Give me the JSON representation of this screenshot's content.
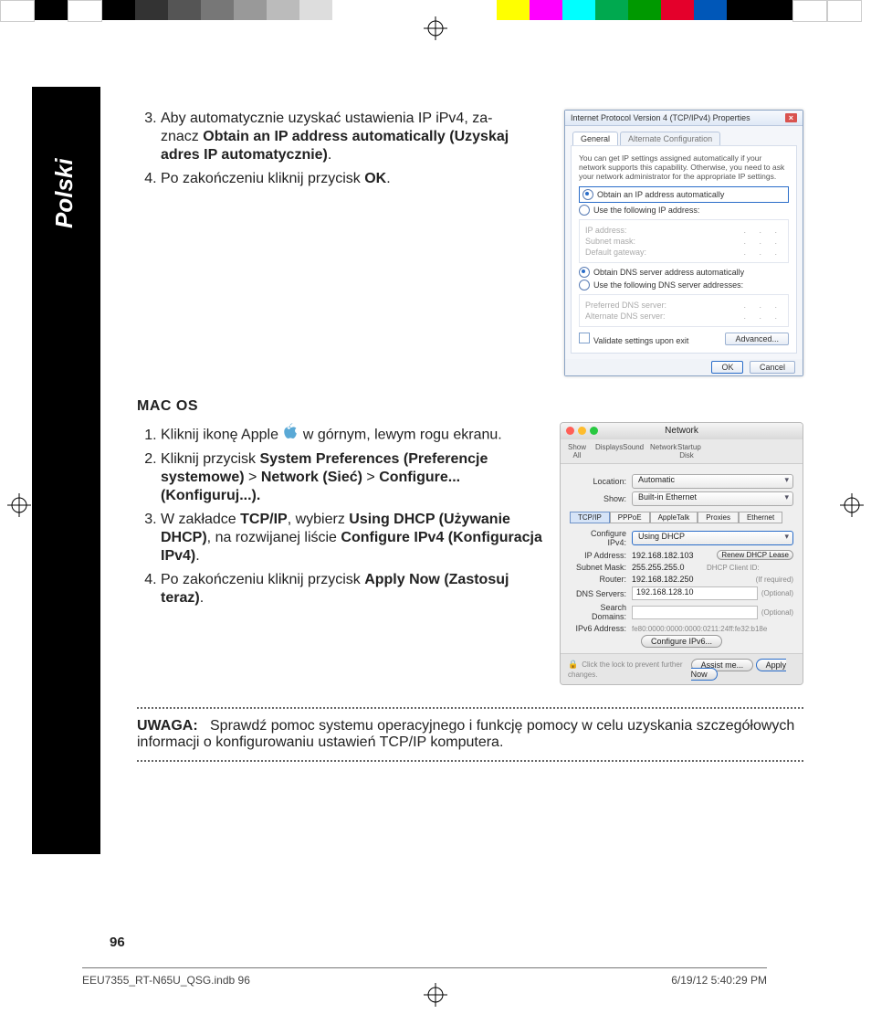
{
  "side_tab": "Polski",
  "section_win": {
    "steps": [
      {
        "num": "3.",
        "pre": "Aby automatycznie uzyskać ustawienia IP iPv4, za-",
        "pre2": "znacz ",
        "bold": "Obtain an IP address automatically (Uzyskaj adres IP automatycznie)",
        "post": "."
      },
      {
        "num": "4.",
        "text_pre": "Po zakończeniu kliknij przycisk ",
        "bold": "OK",
        "post": "."
      }
    ]
  },
  "win_dialog": {
    "title": "Internet Protocol Version 4 (TCP/IPv4) Properties",
    "tabs": [
      "General",
      "Alternate Configuration"
    ],
    "hint": "You can get IP settings assigned automatically if your network supports this capability. Otherwise, you need to ask your network administrator for the appropriate IP settings.",
    "radio_auto_ip": "Obtain an IP address automatically",
    "radio_use_ip": "Use the following IP address:",
    "fields_ip": [
      "IP address:",
      "Subnet mask:",
      "Default gateway:"
    ],
    "radio_auto_dns": "Obtain DNS server address automatically",
    "radio_use_dns": "Use the following DNS server addresses:",
    "fields_dns": [
      "Preferred DNS server:",
      "Alternate DNS server:"
    ],
    "validate": "Validate settings upon exit",
    "advanced": "Advanced...",
    "ok": "OK",
    "cancel": "Cancel"
  },
  "mac_heading": "MAC OS",
  "section_mac": {
    "steps": [
      {
        "num": "1.",
        "pre": "Kliknij ikonę Apple ",
        "post": " w górnym, lewym rogu ekranu."
      },
      {
        "num": "2.",
        "pre": "Kliknij przycisk ",
        "bold": "System Preferences (Preferencje systemowe)",
        "mid1": " > ",
        "bold2": "Network (Sieć)",
        "mid2": " > ",
        "bold3": "Configure... (Konfiguruj...).",
        "post": ""
      },
      {
        "num": "3.",
        "pre": "W zakładce ",
        "bold": "TCP/IP",
        "mid1": ", wybierz ",
        "bold2": "Using DHCP (Używanie DHCP)",
        "mid2": ", na rozwijanej liście ",
        "bold3": "Configure IPv4 (Konfiguracja IPv4)",
        "post": "."
      },
      {
        "num": "4.",
        "pre": "Po zakończeniu kliknij przycisk  ",
        "bold": "Apply Now (Zastosuj teraz)",
        "post": "."
      }
    ]
  },
  "mac_window": {
    "title": "Network",
    "toolbar": [
      "Show All",
      "Displays",
      "Sound",
      "Network",
      "Startup Disk"
    ],
    "loc_label": "Location:",
    "loc_value": "Automatic",
    "show_label": "Show:",
    "show_value": "Built-in Ethernet",
    "segtabs": [
      "TCP/IP",
      "PPPoE",
      "AppleTalk",
      "Proxies",
      "Ethernet"
    ],
    "cfg_label": "Configure IPv4:",
    "cfg_value": "Using DHCP",
    "renew": "Renew DHCP Lease",
    "ip_label": "IP Address:",
    "ip_value": "192.168.182.103",
    "mask_label": "Subnet Mask:",
    "mask_value": "255.255.255.0",
    "client_label": "DHCP Client ID:",
    "client_hint": "(If required)",
    "router_label": "Router:",
    "router_value": "192.168.182.250",
    "dns_label": "DNS Servers:",
    "dns_value": "192.168.128.10",
    "dns_hint": "(Optional)",
    "search_label": "Search Domains:",
    "search_hint": "(Optional)",
    "ipv6_label": "IPv6 Address:",
    "ipv6_value": "fe80:0000:0000:0000:0211:24ff:fe32:b18e",
    "cfg6": "Configure IPv6...",
    "lock_text": "Click the lock to prevent further changes.",
    "assist": "Assist me...",
    "apply": "Apply Now"
  },
  "note": {
    "label": "UWAGA:",
    "text": "Sprawdź pomoc systemu operacyjnego i funkcję pomocy w celu uzyskania szczegółowych informacji o konfigurowaniu ustawień TCP/IP komputera."
  },
  "page_number": "96",
  "footer": {
    "file": "EEU7355_RT-N65U_QSG.indb   96",
    "stamp": "6/19/12   5:40:29 PM"
  },
  "colorbar": [
    "#fff",
    "#000",
    "#fff",
    "#000",
    "#fff",
    "#000",
    "#fff",
    "#000",
    "#fff",
    "#000",
    "#fff",
    "#000",
    "",
    "",
    "",
    "#ffff00",
    "#ff00ff",
    "#00ffff",
    "#00a651",
    "#009900",
    "#ff0000",
    "#0000ff",
    "#000",
    "#000",
    "#fff",
    "#fff"
  ]
}
